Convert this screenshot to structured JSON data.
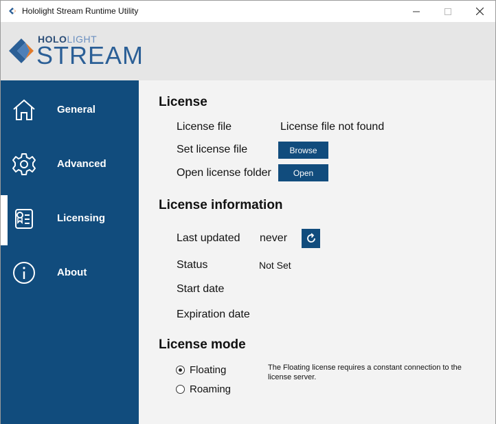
{
  "window": {
    "title": "Hololight Stream Runtime Utility"
  },
  "banner": {
    "brand_small_bold": "HOLO",
    "brand_small_light": "LIGHT",
    "brand_big": "STREAM"
  },
  "sidebar": {
    "items": [
      {
        "label": "General",
        "icon": "home-icon"
      },
      {
        "label": "Advanced",
        "icon": "gear-icon"
      },
      {
        "label": "Licensing",
        "icon": "certificate-icon",
        "active": true
      },
      {
        "label": "About",
        "icon": "info-icon"
      }
    ]
  },
  "license": {
    "title": "License",
    "file_label": "License file",
    "file_value": "License file not found",
    "set_label": "Set license file",
    "browse_button": "Browse",
    "open_folder_label": "Open license folder",
    "open_button": "Open"
  },
  "license_info": {
    "title": "License information",
    "last_updated_label": "Last updated",
    "last_updated_value": "never",
    "status_label": "Status",
    "status_value": "Not Set",
    "start_date_label": "Start date",
    "expiration_label": "Expiration date"
  },
  "license_mode": {
    "title": "License mode",
    "options": [
      {
        "label": "Floating",
        "selected": true
      },
      {
        "label": "Roaming",
        "selected": false
      }
    ],
    "description": "The Floating license requires a constant connection to the license server."
  },
  "colors": {
    "accent": "#114c7d",
    "banner_bg": "#e6e6e6",
    "main_bg": "#f3f3f3"
  }
}
